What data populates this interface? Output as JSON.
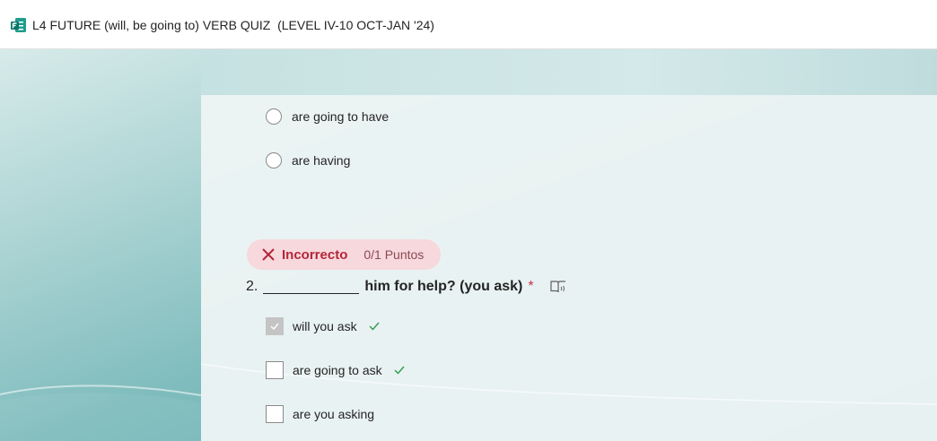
{
  "header": {
    "title": "L4 FUTURE (will, be going to) VERB QUIZ  (LEVEL IV-10 OCT-JAN '24)"
  },
  "q1": {
    "options": [
      {
        "label": "are going to have"
      },
      {
        "label": "are having"
      }
    ]
  },
  "q2": {
    "result": {
      "label": "Incorrecto",
      "points": "0/1 Puntos"
    },
    "number": "2.",
    "text": "him for help? (you ask)",
    "required_mark": "*",
    "options": [
      {
        "label": "will you ask",
        "checked": true,
        "correct": true
      },
      {
        "label": "are going to ask",
        "checked": false,
        "correct": true
      },
      {
        "label": "are you asking",
        "checked": false,
        "correct": false
      }
    ]
  },
  "colors": {
    "incorrect": "#b3263a",
    "correct": "#2e9a4b",
    "accent_teal": "#5ea6a8"
  }
}
